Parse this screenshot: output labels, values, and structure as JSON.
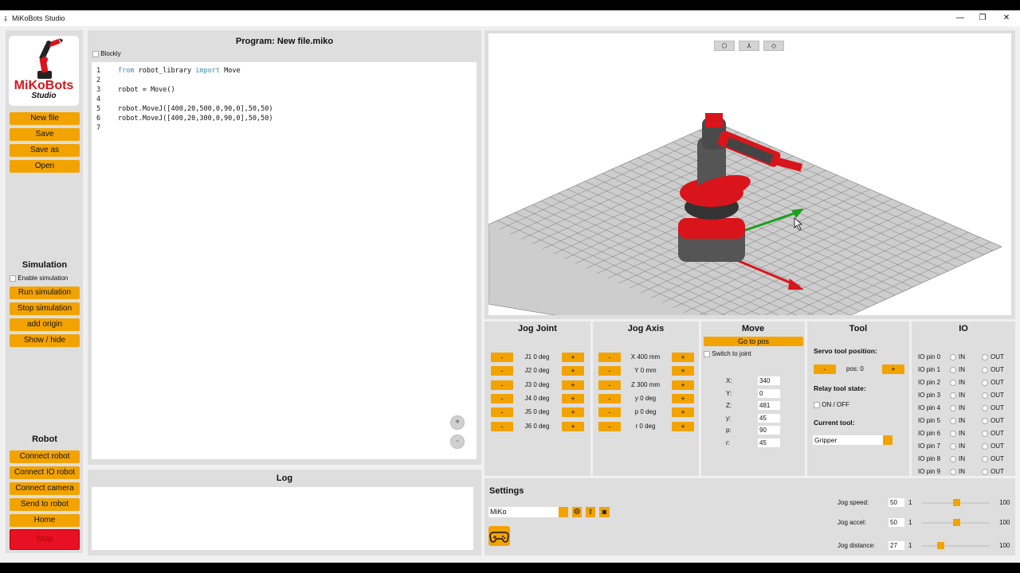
{
  "window": {
    "title": "MiKoBots Studio",
    "icon": "robot-arm-icon",
    "minimize": "—",
    "maximize": "❐",
    "close": "✕"
  },
  "logo": {
    "line1": "MiKoBots",
    "line2": "Studio"
  },
  "file_buttons": [
    "New file",
    "Save",
    "Save as",
    "Open"
  ],
  "simulation": {
    "heading": "Simulation",
    "enable_label": "Enable simulation",
    "buttons": [
      "Run simulation",
      "Stop simulation",
      "add origin",
      "Show / hide"
    ]
  },
  "robot": {
    "heading": "Robot",
    "buttons": [
      "Connect robot",
      "Connect IO robot",
      "Connect camera",
      "Send to robot",
      "Home",
      "Stop"
    ]
  },
  "program": {
    "title": "Program: New file.miko",
    "blockly_label": "Blockly",
    "zoom_in": "+",
    "zoom_out": "-"
  },
  "code": [
    {
      "n": "1",
      "t1": "",
      "k1": "from",
      "t2": " robot_library ",
      "k2": "import",
      "t3": " Move"
    },
    {
      "n": "2",
      "t1": "",
      "k1": "",
      "t2": "",
      "k2": "",
      "t3": ""
    },
    {
      "n": "3",
      "t1": "robot = Move()",
      "k1": "",
      "t2": "",
      "k2": "",
      "t3": ""
    },
    {
      "n": "4",
      "t1": "",
      "k1": "",
      "t2": "",
      "k2": "",
      "t3": ""
    },
    {
      "n": "5",
      "t1": "robot.MoveJ([400,20,500,0,90,0],50,50)",
      "k1": "",
      "t2": "",
      "k2": "",
      "t3": ""
    },
    {
      "n": "6",
      "t1": "robot.MoveJ([400,20,300,0,90,0],50,50)",
      "k1": "",
      "t2": "",
      "k2": "",
      "t3": ""
    },
    {
      "n": "7",
      "t1": "",
      "k1": "",
      "t2": "",
      "k2": "",
      "t3": ""
    }
  ],
  "log": {
    "heading": "Log"
  },
  "viewer": {
    "buttons": [
      "cube-view-icon",
      "axes-view-icon",
      "eye-view-icon"
    ],
    "button_glyphs": [
      "⬡",
      "⅄",
      "◇"
    ]
  },
  "jog_joint": {
    "heading": "Jog Joint",
    "minus": "-",
    "plus": "+",
    "labels": [
      "J1 0 deg",
      "J2 0 deg",
      "J3 0 deg",
      "J4 0 deg",
      "J5 0 deg",
      "J6 0 deg"
    ]
  },
  "jog_axis": {
    "heading": "Jog Axis",
    "minus": "-",
    "plus": "+",
    "labels": [
      "X 400 mm",
      "Y 0 mm",
      "Z 300 mm",
      "y 0 deg",
      "p 0 deg",
      "r 0 deg"
    ]
  },
  "move": {
    "heading": "Move",
    "go_button": "Go to pos",
    "switch_label": "Switch to joint",
    "fields": [
      {
        "label": "X:",
        "value": "340"
      },
      {
        "label": "Y:",
        "value": "0"
      },
      {
        "label": "Z:",
        "value": "481"
      },
      {
        "label": "y:",
        "value": "45"
      },
      {
        "label": "p:",
        "value": "90"
      },
      {
        "label": "r:",
        "value": "45"
      }
    ]
  },
  "tool": {
    "heading": "Tool",
    "servo_label": "Servo tool position:",
    "minus": "-",
    "pos_label": "pos: 0",
    "plus": "+",
    "relay_label": "Relay tool state:",
    "onoff_label": "ON / OFF",
    "current_label": "Current tool:",
    "current_value": "Gripper"
  },
  "io": {
    "heading": "IO",
    "in_label": "IN",
    "out_label": "OUT",
    "pins": [
      "IO pin 0",
      "IO pin 1",
      "IO pin 2",
      "IO pin 3",
      "IO pin 4",
      "IO pin 5",
      "IO pin 6",
      "IO pin 7",
      "IO pin 8",
      "IO pin 9"
    ]
  },
  "settings": {
    "heading": "Settings",
    "robot_name": "MiKo",
    "sliders": [
      {
        "label": "Jog speed:",
        "value": "50",
        "min": "1",
        "max": "100",
        "level": 0.5
      },
      {
        "label": "Jog accel:",
        "value": "50",
        "min": "1",
        "max": "100",
        "level": 0.5
      },
      {
        "label": "Jog distance:",
        "value": "27",
        "min": "1",
        "max": "100",
        "level": 0.27
      }
    ]
  },
  "colors": {
    "accent": "#f2a300",
    "stop": "#e81123",
    "robot_red": "#d9141b"
  }
}
